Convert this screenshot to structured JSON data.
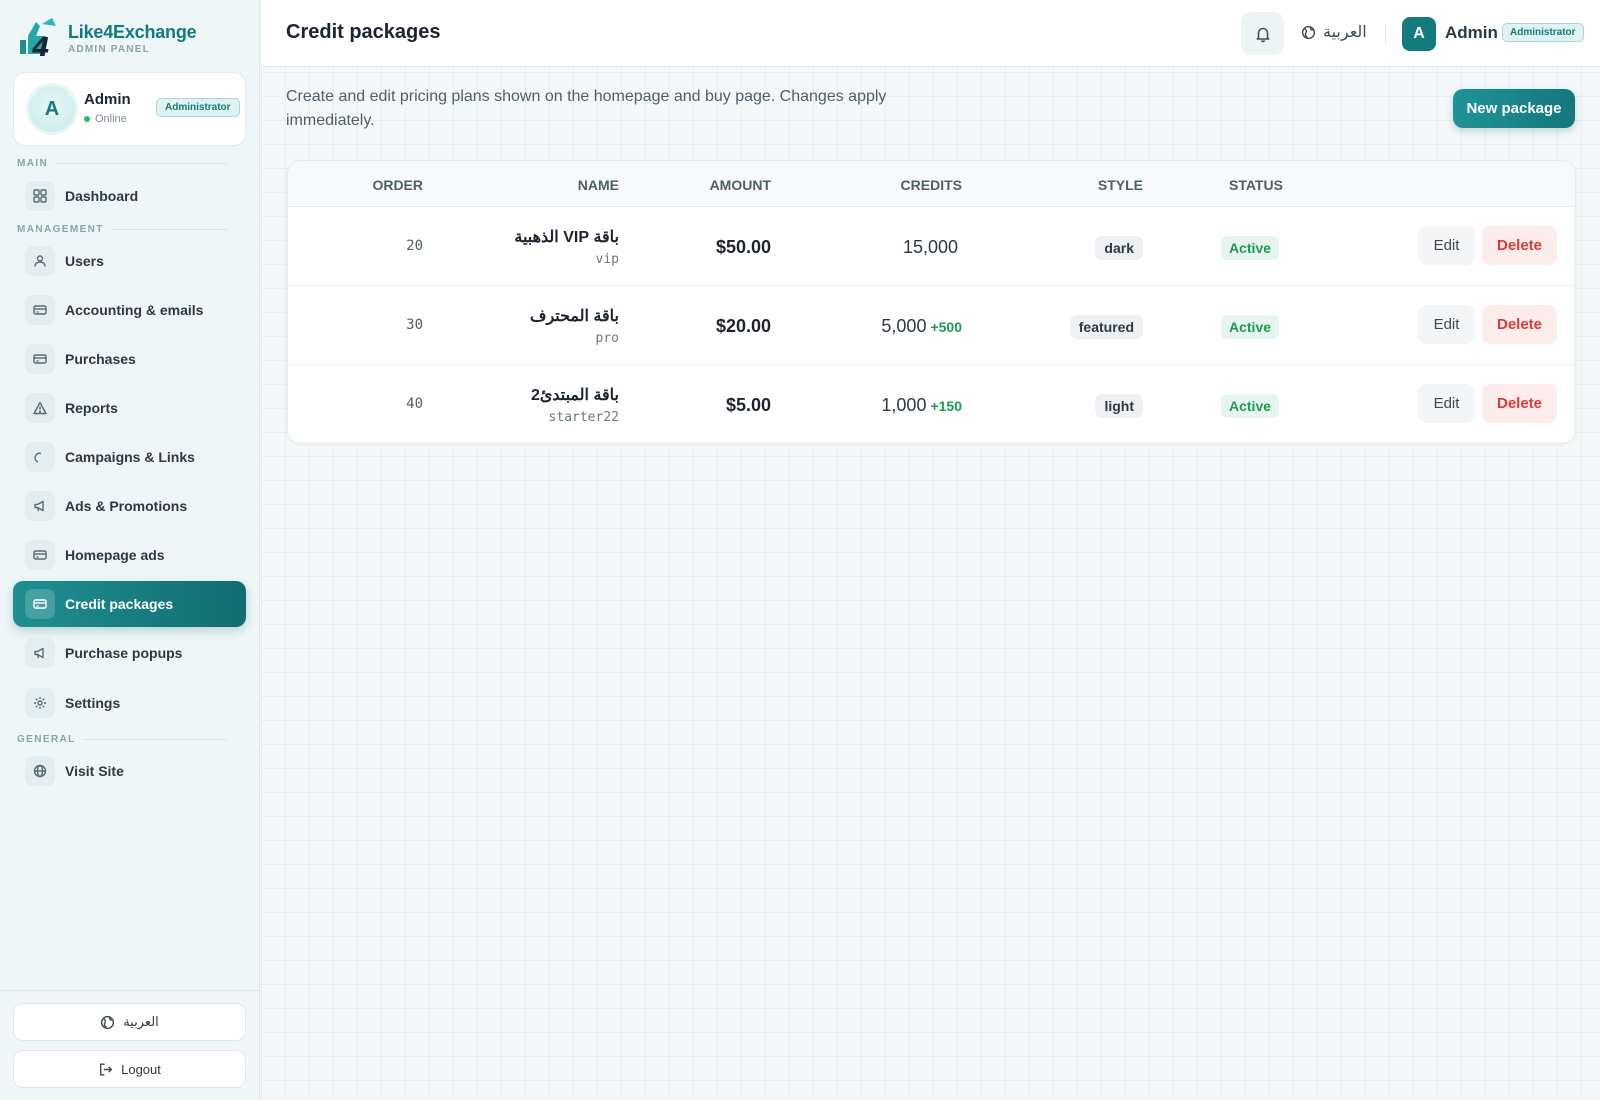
{
  "brand": {
    "name": "Like4Exchange",
    "subtitle": "ADMIN PANEL",
    "logo_mark": "4"
  },
  "user_card": {
    "initial": "A",
    "name": "Admin",
    "status": "Online",
    "role": "Administrator"
  },
  "sidebar": {
    "sections": {
      "main": "MAIN",
      "management": "MANAGEMENT",
      "general": "GENERAL"
    },
    "items": [
      {
        "label": "Dashboard",
        "icon": "grid-icon"
      },
      {
        "label": "Users",
        "icon": "users-icon"
      },
      {
        "label": "Accounting & emails",
        "icon": "card-icon"
      },
      {
        "label": "Purchases",
        "icon": "card-icon"
      },
      {
        "label": "Reports",
        "icon": "alert-triangle-icon"
      },
      {
        "label": "Campaigns & Links",
        "icon": "link-icon"
      },
      {
        "label": "Ads & Promotions",
        "icon": "megaphone-icon"
      },
      {
        "label": "Homepage ads",
        "icon": "card-icon"
      },
      {
        "label": "Credit packages",
        "icon": "card-icon",
        "active": true
      },
      {
        "label": "Purchase popups",
        "icon": "megaphone-icon"
      },
      {
        "label": "Settings",
        "icon": "gear-icon"
      },
      {
        "label": "Visit Site",
        "icon": "globe-icon"
      }
    ],
    "language_button": "العربية",
    "logout_button": "Logout"
  },
  "topbar": {
    "title": "Credit packages",
    "language": "العربية",
    "admin_initial": "A",
    "admin_name": "Admin",
    "admin_role": "Administrator"
  },
  "main": {
    "description": "Create and edit pricing plans shown on the homepage and buy page. Changes apply immediately.",
    "new_button": "New package"
  },
  "table": {
    "headers": {
      "order": "ORDER",
      "name": "NAME",
      "amount": "AMOUNT",
      "credits": "CREDITS",
      "style": "STYLE",
      "status": "STATUS"
    },
    "rows": [
      {
        "order": "20",
        "name": "باقة VIP الذهبية",
        "slug": "vip",
        "amount": "$50.00",
        "credits": "15,000",
        "bonus": "",
        "style": "dark",
        "status": "Active",
        "edit": "Edit",
        "delete": "Delete"
      },
      {
        "order": "30",
        "name": "باقة المحترف",
        "slug": "pro",
        "amount": "$20.00",
        "credits": "5,000",
        "bonus": "+500",
        "style": "featured",
        "status": "Active",
        "edit": "Edit",
        "delete": "Delete"
      },
      {
        "order": "40",
        "name": "باقة المبتدئ2",
        "slug": "starter22",
        "amount": "$5.00",
        "credits": "1,000",
        "bonus": "+150",
        "style": "light",
        "status": "Active",
        "edit": "Edit",
        "delete": "Delete"
      }
    ]
  },
  "colors": {
    "accent": "#137a7e",
    "success": "#1c9b55",
    "danger": "#d93a3a"
  }
}
